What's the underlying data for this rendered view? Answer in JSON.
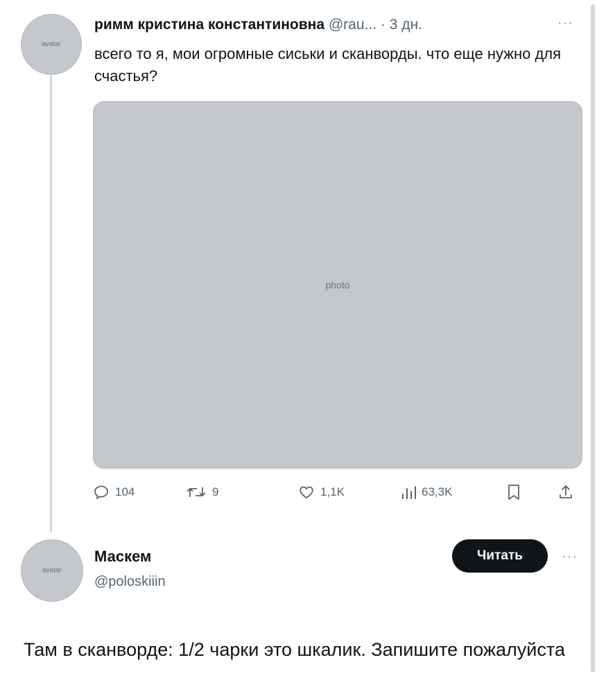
{
  "tweet": {
    "author_name": "римм кристина константиновна",
    "handle": "@rau...",
    "time": "· 3 дн.",
    "more": "···",
    "text": "всего то я, мои огромные сиськи и сканворды. что еще нужно для счастья?",
    "stats": {
      "replies": "104",
      "retweets": "9",
      "likes": "1,1K",
      "views": "63,3K"
    },
    "icons": [
      "reply-icon",
      "retweet-icon",
      "like-icon",
      "views-icon",
      "bookmark-icon",
      "share-icon"
    ]
  },
  "reply_author": {
    "name": "Маскем",
    "handle": "@poloskiiin",
    "follow_label": "Читать",
    "more": "···"
  },
  "reply_text": "Там в сканворде: 1/2 чарки это шкалик. Запишите пожалуйста",
  "colors": {
    "text": "#0f1419",
    "muted": "#536471",
    "thread_line": "#cfd9de",
    "button_bg": "#0f1419",
    "button_text": "#ffffff"
  }
}
